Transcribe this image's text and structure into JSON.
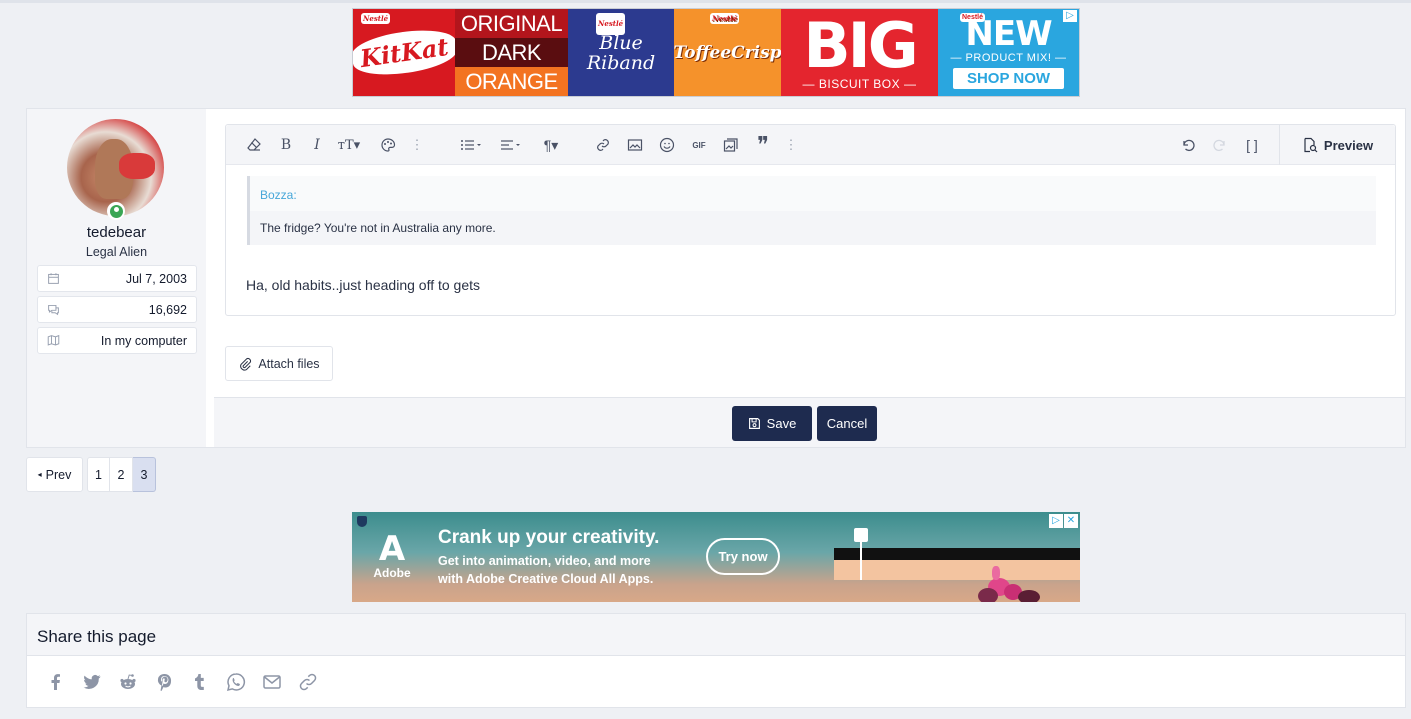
{
  "ad_top": {
    "kitkat": "KitKat",
    "nestle": "Nestlé",
    "flavours": [
      "ORIGINAL",
      "DARK",
      "ORANGE"
    ],
    "blue_riband": "Blue Riband",
    "toffee_crisp": "ToffeeCrisp",
    "big": "BIG",
    "big_sub": "— BISCUIT BOX —",
    "new": "NEW",
    "product_mix": "— PRODUCT MIX! —",
    "shop_now": "SHOP NOW",
    "ad_choice_icon": "adchoices-icon"
  },
  "user": {
    "username": "tedebear",
    "title": "Legal Alien",
    "joined": "Jul 7, 2003",
    "messages": "16,692",
    "location": "In my computer",
    "status": "online"
  },
  "editor": {
    "toolbar_icons": [
      "eraser-icon",
      "bold-icon",
      "italic-icon",
      "text-size-icon",
      "palette-icon",
      "more-icon",
      "list-icon",
      "align-icon",
      "paragraph-icon",
      "link-icon",
      "image-icon",
      "smilie-icon",
      "gif-icon",
      "media-icon",
      "quote-icon",
      "more-icon",
      "undo-icon",
      "redo-icon",
      "bbcode-toggle-icon"
    ],
    "gif_label": "GIF",
    "preview_label": "Preview",
    "quote_author": "Bozza:",
    "quote_text": "The fridge? You're not in Australia any more.",
    "body_text": "Ha, old habits..just heading off to gets",
    "attach_label": "Attach files",
    "save_label": "Save",
    "cancel_label": "Cancel"
  },
  "pagination": {
    "prev_label": "Prev",
    "pages": [
      "1",
      "2",
      "3"
    ],
    "current": "3"
  },
  "ad_adobe": {
    "logo_text": "Adobe",
    "headline": "Crank up your creativity.",
    "sub_line1": "Get into animation, video, and more",
    "sub_line2": "with Adobe Creative Cloud All Apps.",
    "cta": "Try now"
  },
  "share": {
    "title": "Share this page",
    "icons": [
      "facebook-icon",
      "twitter-icon",
      "reddit-icon",
      "pinterest-icon",
      "tumblr-icon",
      "whatsapp-icon",
      "email-icon",
      "link-icon"
    ]
  }
}
